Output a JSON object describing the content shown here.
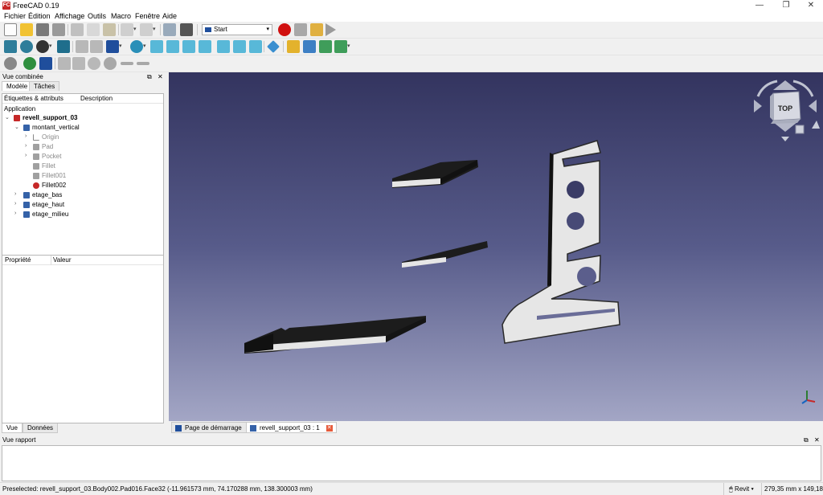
{
  "window": {
    "title": "FreeCAD 0.19",
    "logo": "FC"
  },
  "menu": [
    "Fichier",
    "Édition",
    "Affichage",
    "Outils",
    "Macro",
    "Fenêtre",
    "Aide"
  ],
  "toolbar": {
    "workbench": "Start"
  },
  "combo": {
    "title": "Vue combinée",
    "tabs": [
      "Modèle",
      "Tâches"
    ],
    "tree_columns": [
      "Étiquettes & attributs",
      "Description"
    ],
    "tree": {
      "application": "Application",
      "document": "revell_support_03",
      "body_open": "montant_vertical",
      "features": [
        "Origin",
        "Pad",
        "Pocket",
        "Fillet",
        "Fillet001",
        "Fillet002"
      ],
      "bodies_closed": [
        "etage_bas",
        "etage_haut",
        "etage_milieu"
      ]
    },
    "property_columns": [
      "Propriété",
      "Valeur"
    ],
    "bottom_tabs": [
      "Vue",
      "Données"
    ]
  },
  "navcube": {
    "face": "TOP"
  },
  "view_tabs": [
    "Page de démarrage",
    "revell_support_03 : 1"
  ],
  "report": {
    "title": "Vue rapport"
  },
  "status": {
    "message": "Preselected: revell_support_03.Body002.Pad016.Face32 (-11.961573 mm, 74.170288 mm, 138.300003 mm)",
    "navigation": "Revit",
    "dimensions": "279,35 mm x 149,18 mm"
  },
  "colors": {
    "view_top": "#33345f",
    "view_bottom": "#a3a6c5",
    "part_light": "#e6e6e6",
    "part_dark": "#1c1c1c",
    "record_red": "#d01010"
  }
}
